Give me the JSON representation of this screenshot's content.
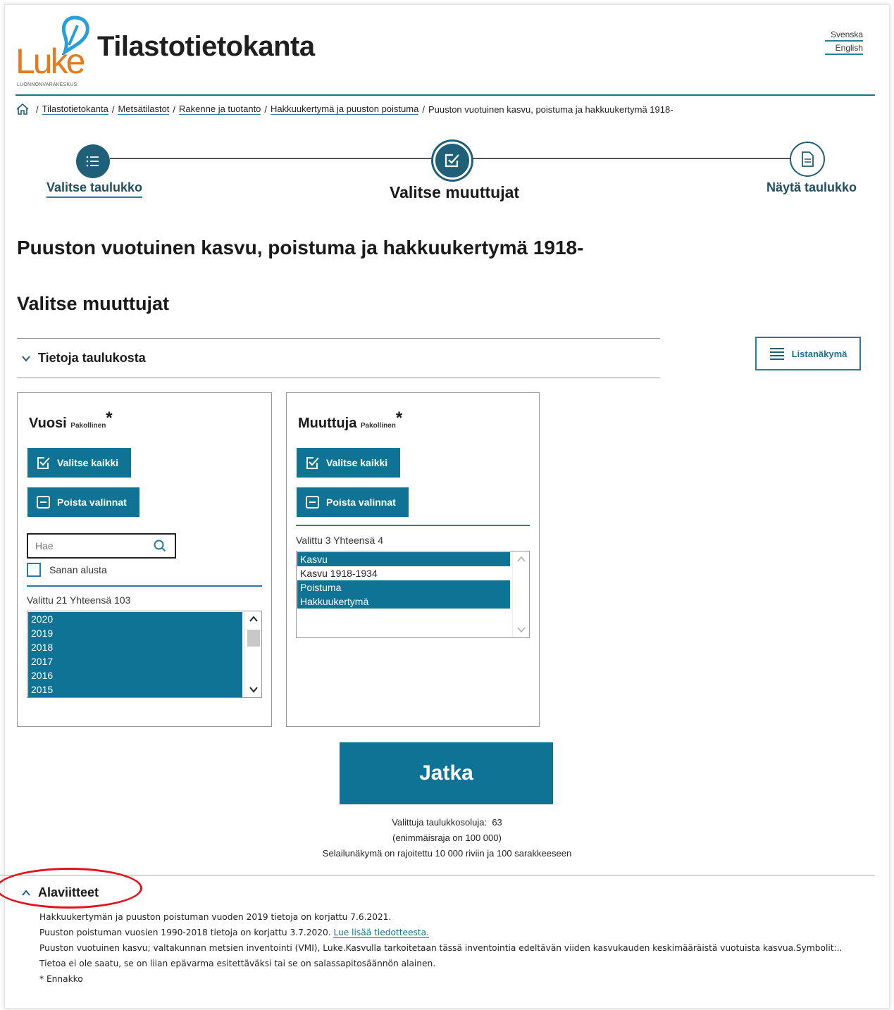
{
  "header": {
    "logo_text": "Luke",
    "logo_sub": "LUONNONVARAKESKUS",
    "site_title": "Tilastotietokanta",
    "lang_sv": "Svenska",
    "lang_en": "English"
  },
  "breadcrumb": {
    "items": [
      "Tilastotietokanta",
      "Metsätilastot",
      "Rakenne ja tuotanto",
      "Hakkuukertymä ja puuston poistuma"
    ],
    "current": "Puuston vuotuinen kasvu, poistuma ja hakkuukertymä 1918-",
    "separator": "/"
  },
  "stepper": {
    "step1": "Valitse taulukko",
    "step2": "Valitse muuttujat",
    "step3": "Näytä taulukko"
  },
  "main": {
    "title": "Puuston vuotuinen kasvu, poistuma ja hakkuukertymä 1918-",
    "subtitle": "Valitse muuttujat",
    "accordion_label": "Tietoja taulukosta",
    "list_view_label": "Listanäkymä"
  },
  "vuosi": {
    "title": "Vuosi",
    "required": "Pakollinen",
    "star": "*",
    "select_all": "Valitse kaikki",
    "clear": "Poista valinnat",
    "search_placeholder": "Hae",
    "checkbox_label": "Sanan alusta",
    "count": "Valittu 21 Yhteensä 103",
    "options": [
      "2020",
      "2019",
      "2018",
      "2017",
      "2016",
      "2015"
    ]
  },
  "muuttuja": {
    "title": "Muuttuja",
    "required": "Pakollinen",
    "star": "*",
    "select_all": "Valitse kaikki",
    "clear": "Poista valinnat",
    "count": "Valittu 3 Yhteensä 4",
    "options": [
      "Kasvu",
      "Kasvu 1918-1934",
      "Poistuma",
      "Hakkuukertymä"
    ]
  },
  "continue": {
    "label": "Jatka",
    "cells_label": "Valittuja taulukkosoluja:",
    "cells_value": "63",
    "limit": "(enimmäisraja on 100 000)",
    "browse_limit": "Selailunäkymä on rajoitettu 10 000 riviin ja 100 sarakkeeseen"
  },
  "footnotes": {
    "title": "Alaviitteet",
    "line1": "Hakkuukertymän ja puuston poistuman vuoden 2019 tietoja on korjattu 7.6.2021.",
    "line2": "Puuston poistuman vuosien 1990-2018 tietoja on korjattu 3.7.2020.",
    "line2_link": "Lue lisää tiedotteesta.",
    "line3": "Puuston vuotuinen kasvu; valtakunnan metsien inventointi (VMI), Luke.Kasvulla tarkoitetaan tässä inventointia edeltävän viiden kasvukauden keskimääräistä vuotuista kasvua.Symbolit:.. Tietoa ei ole saatu, se on liian epävarma esitettäväksi tai se on salassapitosäännön alainen.",
    "line4": "* Ennakko"
  },
  "colors": {
    "primary": "#0f7395",
    "accent_orange": "#e47b1f",
    "accent_blue": "#2a9fd6",
    "highlight_red": "#e0141e"
  }
}
